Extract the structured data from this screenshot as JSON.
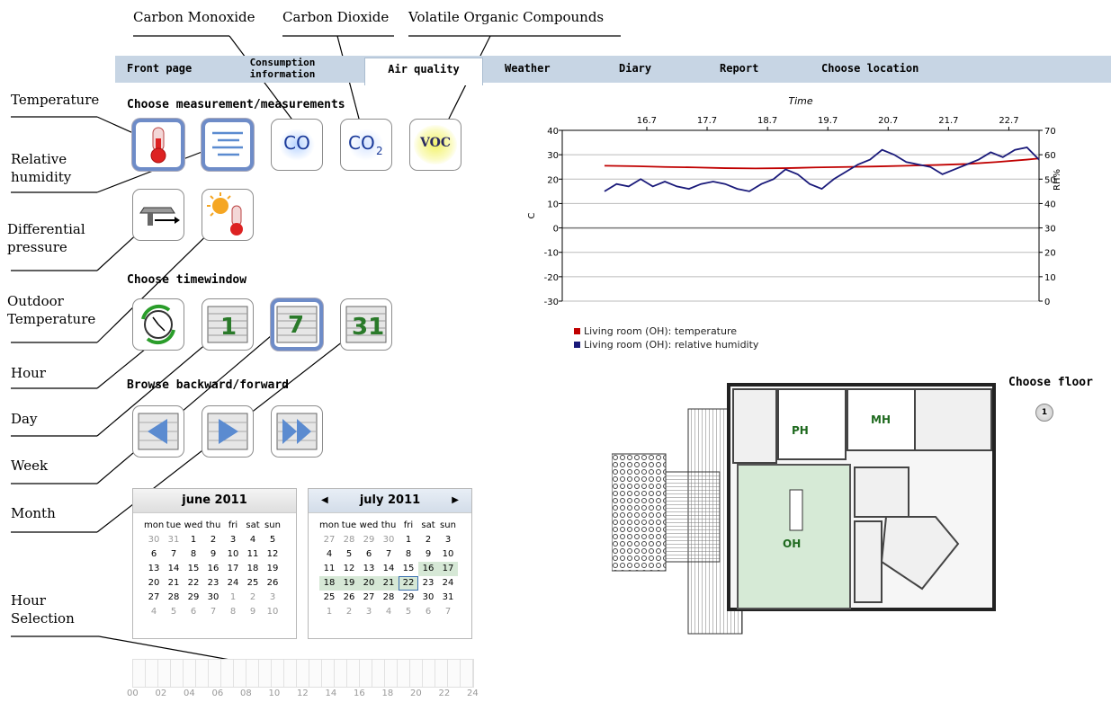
{
  "annotations": {
    "top": {
      "co": "Carbon Monoxide",
      "co2": "Carbon Dioxide",
      "voc": "Volatile Organic Compounds"
    },
    "left": {
      "temperature": "Temperature",
      "relative_humidity": "Relative humidity",
      "differential_pressure": "Differential pressure",
      "outdoor_temperature": "Outdoor Temperature",
      "hour": "Hour",
      "day": "Day",
      "week": "Week",
      "month": "Month",
      "hour_selection": "Hour Selection"
    }
  },
  "tabs": [
    {
      "label": "Front page",
      "active": false
    },
    {
      "label": "Consumption information",
      "active": false
    },
    {
      "label": "Air quality",
      "active": true
    },
    {
      "label": "Weather",
      "active": false
    },
    {
      "label": "Diary",
      "active": false
    },
    {
      "label": "Report",
      "active": false
    },
    {
      "label": "Choose location",
      "active": false
    }
  ],
  "sections": {
    "measurements": "Choose measurement/measurements",
    "timewindow": "Choose timewindow",
    "browse": "Browse backward/forward",
    "floor": "Choose floor"
  },
  "measure_buttons": {
    "co": "CO",
    "co2": "CO",
    "co2_sub": "2",
    "voc": "VOC",
    "temperature_selected": true,
    "humidity_selected": true
  },
  "time_buttons": {
    "day": "1",
    "week": "7",
    "month": "31",
    "selected": "week"
  },
  "calendars": [
    {
      "title": "june 2011",
      "headers": [
        "mon",
        "tue",
        "wed",
        "thu",
        "fri",
        "sat",
        "sun"
      ],
      "rows": [
        [
          "30",
          "31",
          "1",
          "2",
          "3",
          "4",
          "5"
        ],
        [
          "6",
          "7",
          "8",
          "9",
          "10",
          "11",
          "12"
        ],
        [
          "13",
          "14",
          "15",
          "16",
          "17",
          "18",
          "19"
        ],
        [
          "20",
          "21",
          "22",
          "23",
          "24",
          "25",
          "26"
        ],
        [
          "27",
          "28",
          "29",
          "30",
          "1",
          "2",
          "3"
        ],
        [
          "4",
          "5",
          "6",
          "7",
          "8",
          "9",
          "10"
        ]
      ]
    },
    {
      "title": "july 2011",
      "prev": "◀",
      "next": "▶",
      "headers": [
        "mon",
        "tue",
        "wed",
        "thu",
        "fri",
        "sat",
        "sun"
      ],
      "rows": [
        [
          "27",
          "28",
          "29",
          "30",
          "1",
          "2",
          "3"
        ],
        [
          "4",
          "5",
          "6",
          "7",
          "8",
          "9",
          "10"
        ],
        [
          "11",
          "12",
          "13",
          "14",
          "15",
          "16",
          "17"
        ],
        [
          "18",
          "19",
          "20",
          "21",
          "22",
          "23",
          "24"
        ],
        [
          "25",
          "26",
          "27",
          "28",
          "29",
          "30",
          "31"
        ],
        [
          "1",
          "2",
          "3",
          "4",
          "5",
          "6",
          "7"
        ]
      ]
    }
  ],
  "hour_labels": [
    "00",
    "02",
    "04",
    "06",
    "08",
    "10",
    "12",
    "14",
    "16",
    "18",
    "20",
    "22",
    "24"
  ],
  "floor_button": "1",
  "rooms": {
    "ph": "PH",
    "mh": "MH",
    "oh": "OH"
  },
  "colors": {
    "temperature": "#c00000",
    "humidity": "#1a1a7a",
    "tabbar": "#c7d5e4",
    "selected_button": "#6e8cc8",
    "room_highlight": "#d6ead6"
  },
  "chart_data": {
    "type": "line",
    "title": "Time",
    "xlabel": "Time",
    "ylabel_left": "C",
    "ylabel_right": "RH%",
    "x_ticks": [
      "16.7",
      "17.7",
      "18.7",
      "19.7",
      "20.7",
      "21.7",
      "22.7"
    ],
    "x_range": [
      15.3,
      23.2
    ],
    "ylim_left": [
      -30,
      40
    ],
    "ylim_right": [
      0,
      70
    ],
    "y_ticks_left": [
      "40",
      "30",
      "20",
      "10",
      "0",
      "-10",
      "-20",
      "-30"
    ],
    "y_ticks_right": [
      "70",
      "60",
      "50",
      "40",
      "30",
      "20",
      "10",
      "0"
    ],
    "series": [
      {
        "name": "Living room (OH): temperature",
        "axis": "left",
        "color": "#c00000",
        "x": [
          16.0,
          16.5,
          17.0,
          17.5,
          18.0,
          18.5,
          19.0,
          19.5,
          20.0,
          20.5,
          21.0,
          21.5,
          22.0,
          22.5,
          23.0,
          23.2
        ],
        "y": [
          25.5,
          25.3,
          25.0,
          24.8,
          24.5,
          24.4,
          24.5,
          24.8,
          25.0,
          25.2,
          25.5,
          25.8,
          26.2,
          27.0,
          28.0,
          28.5
        ]
      },
      {
        "name": "Living room (OH): relative humidity",
        "axis": "right",
        "color": "#1a1a7a",
        "x": [
          16.0,
          16.2,
          16.4,
          16.6,
          16.8,
          17.0,
          17.2,
          17.4,
          17.6,
          17.8,
          18.0,
          18.2,
          18.4,
          18.6,
          18.8,
          19.0,
          19.2,
          19.4,
          19.6,
          19.8,
          20.0,
          20.2,
          20.4,
          20.6,
          20.8,
          21.0,
          21.2,
          21.4,
          21.6,
          21.8,
          22.0,
          22.2,
          22.4,
          22.6,
          22.8,
          23.0,
          23.2
        ],
        "y": [
          45,
          48,
          47,
          50,
          47,
          49,
          47,
          46,
          48,
          49,
          48,
          46,
          45,
          48,
          50,
          54,
          52,
          48,
          46,
          50,
          53,
          56,
          58,
          62,
          60,
          57,
          56,
          55,
          52,
          54,
          56,
          58,
          61,
          59,
          62,
          63,
          58
        ]
      }
    ]
  }
}
